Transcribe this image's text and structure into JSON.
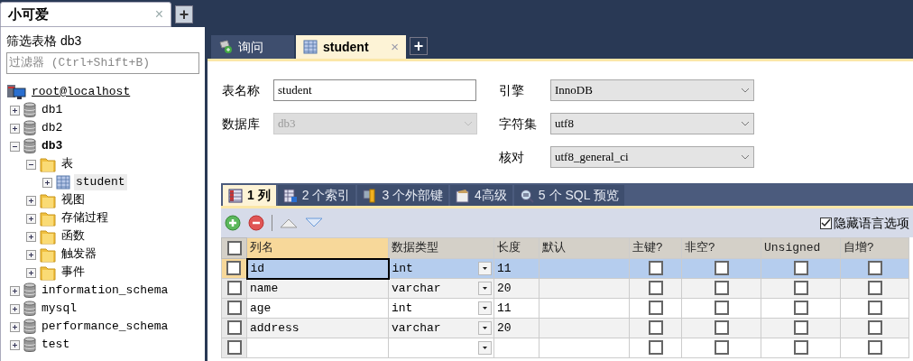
{
  "app_tab": {
    "label": "小可爱",
    "close": "×"
  },
  "new_app_tab": "+",
  "sidebar": {
    "title": "筛选表格 db3",
    "filter": {
      "placeholder": "过滤器 (Ctrl+Shift+B)"
    },
    "tree": [
      {
        "label": "root@localhost",
        "kind": "server",
        "selected": false,
        "children": [
          {
            "label": "db1",
            "kind": "database",
            "expanded": false,
            "current": false,
            "selected": false
          },
          {
            "label": "db2",
            "kind": "database",
            "expanded": false,
            "current": false,
            "selected": false
          },
          {
            "label": "db3",
            "kind": "database",
            "expanded": true,
            "current": true,
            "selected": false,
            "children": [
              {
                "label": "表",
                "kind": "folder",
                "expanded": true,
                "selected": false,
                "children": [
                  {
                    "label": "student",
                    "kind": "table",
                    "expanded": false,
                    "selected": true
                  }
                ]
              },
              {
                "label": "视图",
                "kind": "folder",
                "expanded": false,
                "selected": false
              },
              {
                "label": "存储过程",
                "kind": "folder",
                "expanded": false,
                "selected": false
              },
              {
                "label": "函数",
                "kind": "folder",
                "expanded": false,
                "selected": false
              },
              {
                "label": "触发器",
                "kind": "folder",
                "expanded": false,
                "selected": false
              },
              {
                "label": "事件",
                "kind": "folder",
                "expanded": false,
                "selected": false
              }
            ]
          },
          {
            "label": "information_schema",
            "kind": "database",
            "expanded": false,
            "current": false,
            "selected": false
          },
          {
            "label": "mysql",
            "kind": "database",
            "expanded": false,
            "current": false,
            "selected": false
          },
          {
            "label": "performance_schema",
            "kind": "database",
            "expanded": false,
            "current": false,
            "selected": false
          },
          {
            "label": "test",
            "kind": "database",
            "expanded": false,
            "current": false,
            "selected": false
          }
        ]
      }
    ]
  },
  "editor_tabs": [
    {
      "label": "询问",
      "kind": "query",
      "selected": false
    },
    {
      "label": "student",
      "kind": "table",
      "selected": true,
      "close": "×"
    }
  ],
  "new_editor_tab": "+",
  "form": {
    "table_name": {
      "label": "表名称",
      "value": "student"
    },
    "database": {
      "label": "数据库",
      "value": "db3",
      "disabled": true
    },
    "engine": {
      "label": "引擎",
      "value": "InnoDB"
    },
    "charset": {
      "label": "字符集",
      "value": "utf8"
    },
    "collation": {
      "label": "核对",
      "value": "utf8_general_ci"
    }
  },
  "section_tabs": [
    {
      "label": "1 列",
      "kind": "columns",
      "selected": true
    },
    {
      "label": "2 个索引",
      "kind": "indexes",
      "selected": false
    },
    {
      "label": "3 个外部键",
      "kind": "foreign_keys",
      "selected": false
    },
    {
      "label": "4高级",
      "kind": "advanced",
      "selected": false
    },
    {
      "label": "5 个 SQL 预览",
      "kind": "sql",
      "selected": false
    }
  ],
  "hide_language_options": {
    "label": "隐藏语言选项",
    "checked": true
  },
  "grid": {
    "select_all": {
      "checked": false
    },
    "columns": [
      {
        "label": "列名",
        "selected": true
      },
      {
        "label": "数据类型",
        "selected": false
      },
      {
        "label": "长度",
        "selected": false
      },
      {
        "label": "默认",
        "selected": false
      },
      {
        "label": "主键?",
        "selected": false
      },
      {
        "label": "非空?",
        "selected": false
      },
      {
        "label": "Unsigned",
        "selected": false
      },
      {
        "label": "自增?",
        "selected": false
      }
    ],
    "rows": [
      {
        "kind": "field",
        "checked": false,
        "selected": true,
        "name": "id",
        "type": "int",
        "length": "11",
        "primary_key": false,
        "not_null": false,
        "unsigned": false,
        "auto_increment": false
      },
      {
        "kind": "field",
        "checked": false,
        "selected": false,
        "name": "name",
        "type": "varchar",
        "length": "20",
        "primary_key": false,
        "not_null": false,
        "unsigned": false,
        "auto_increment": false
      },
      {
        "kind": "field",
        "checked": false,
        "selected": false,
        "name": "age",
        "type": "int",
        "length": "11",
        "primary_key": false,
        "not_null": false,
        "unsigned": false,
        "auto_increment": false
      },
      {
        "kind": "field",
        "checked": false,
        "selected": false,
        "name": "address",
        "type": "varchar",
        "length": "20",
        "primary_key": false,
        "not_null": false,
        "unsigned": false,
        "auto_increment": false
      },
      {
        "kind": "new",
        "checked": false,
        "selected": false,
        "primary_key": false,
        "not_null": false,
        "unsigned": false,
        "auto_increment": false
      }
    ]
  }
}
